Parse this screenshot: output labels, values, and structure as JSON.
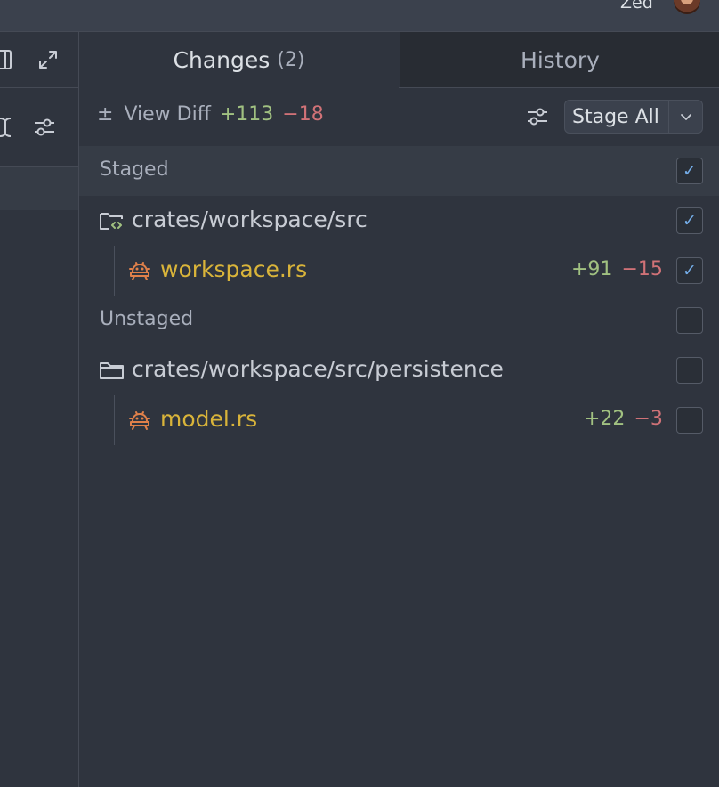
{
  "user": {
    "name": "Zed"
  },
  "tabs": {
    "changes_label": "Changes",
    "changes_count": "(2)",
    "history_label": "History"
  },
  "toolbar": {
    "view_diff_icon": "±",
    "view_diff_label": "View Diff",
    "additions": "+113",
    "deletions": "−18",
    "stage_all_label": "Stage All"
  },
  "sections": [
    {
      "label": "Staged",
      "checked": true,
      "folder": {
        "path": "crates/workspace/src",
        "checked": true
      },
      "files": [
        {
          "name": "workspace.rs",
          "additions": "+91",
          "deletions": "−15",
          "checked": true
        }
      ]
    },
    {
      "label": "Unstaged",
      "checked": false,
      "folder": {
        "path": "crates/workspace/src/persistence",
        "checked": false
      },
      "files": [
        {
          "name": "model.rs",
          "additions": "+22",
          "deletions": "−3",
          "checked": false
        }
      ]
    }
  ],
  "colors": {
    "addition": "#a1c181",
    "deletion": "#d07277",
    "accent_check": "#74ade8",
    "file_name": "#d9b43a",
    "rust_icon": "#e0804a"
  },
  "icons": {
    "panel": "panel-icon",
    "expand": "maximize-icon",
    "text_cursor": "text-cursor-icon",
    "filter": "sliders-icon",
    "folder_modified": "folder-code-icon",
    "folder": "folder-icon",
    "rust": "rust-file-icon",
    "chevron": "chevron-down-icon",
    "check": "check-icon"
  }
}
